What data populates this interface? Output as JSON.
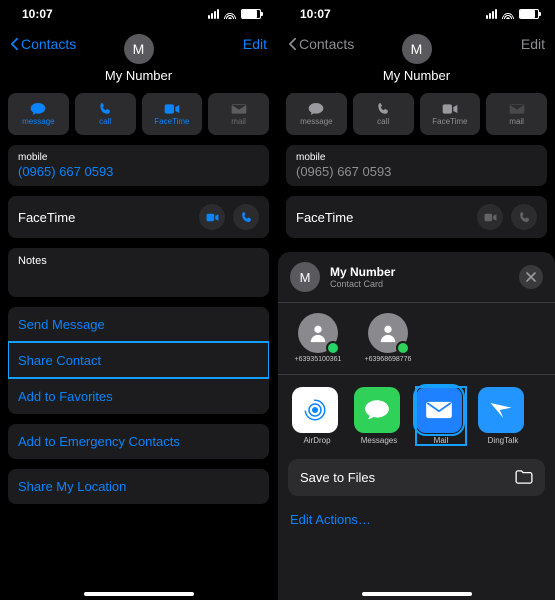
{
  "status": {
    "time": "10:07"
  },
  "nav": {
    "back": "Contacts",
    "edit": "Edit"
  },
  "contact": {
    "initial": "M",
    "name": "My Number",
    "mobile_label": "mobile",
    "mobile_value": "(0965) 667 0593",
    "facetime_label": "FaceTime",
    "notes_label": "Notes"
  },
  "actions": {
    "message": "message",
    "call": "call",
    "facetime": "FaceTime",
    "mail": "mail"
  },
  "links": {
    "send_message": "Send Message",
    "share_contact": "Share Contact",
    "add_favorites": "Add to Favorites",
    "add_emergency": "Add to Emergency Contacts",
    "share_location": "Share My Location"
  },
  "sheet": {
    "title": "My Number",
    "subtitle": "Contact Card",
    "people": [
      {
        "number": "+63935100361"
      },
      {
        "number": "+63968698776"
      }
    ],
    "apps": {
      "airdrop": "AirDrop",
      "messages": "Messages",
      "mail": "Mail",
      "dingtalk": "DingTalk"
    },
    "save_files": "Save to Files",
    "edit_actions": "Edit Actions…"
  }
}
